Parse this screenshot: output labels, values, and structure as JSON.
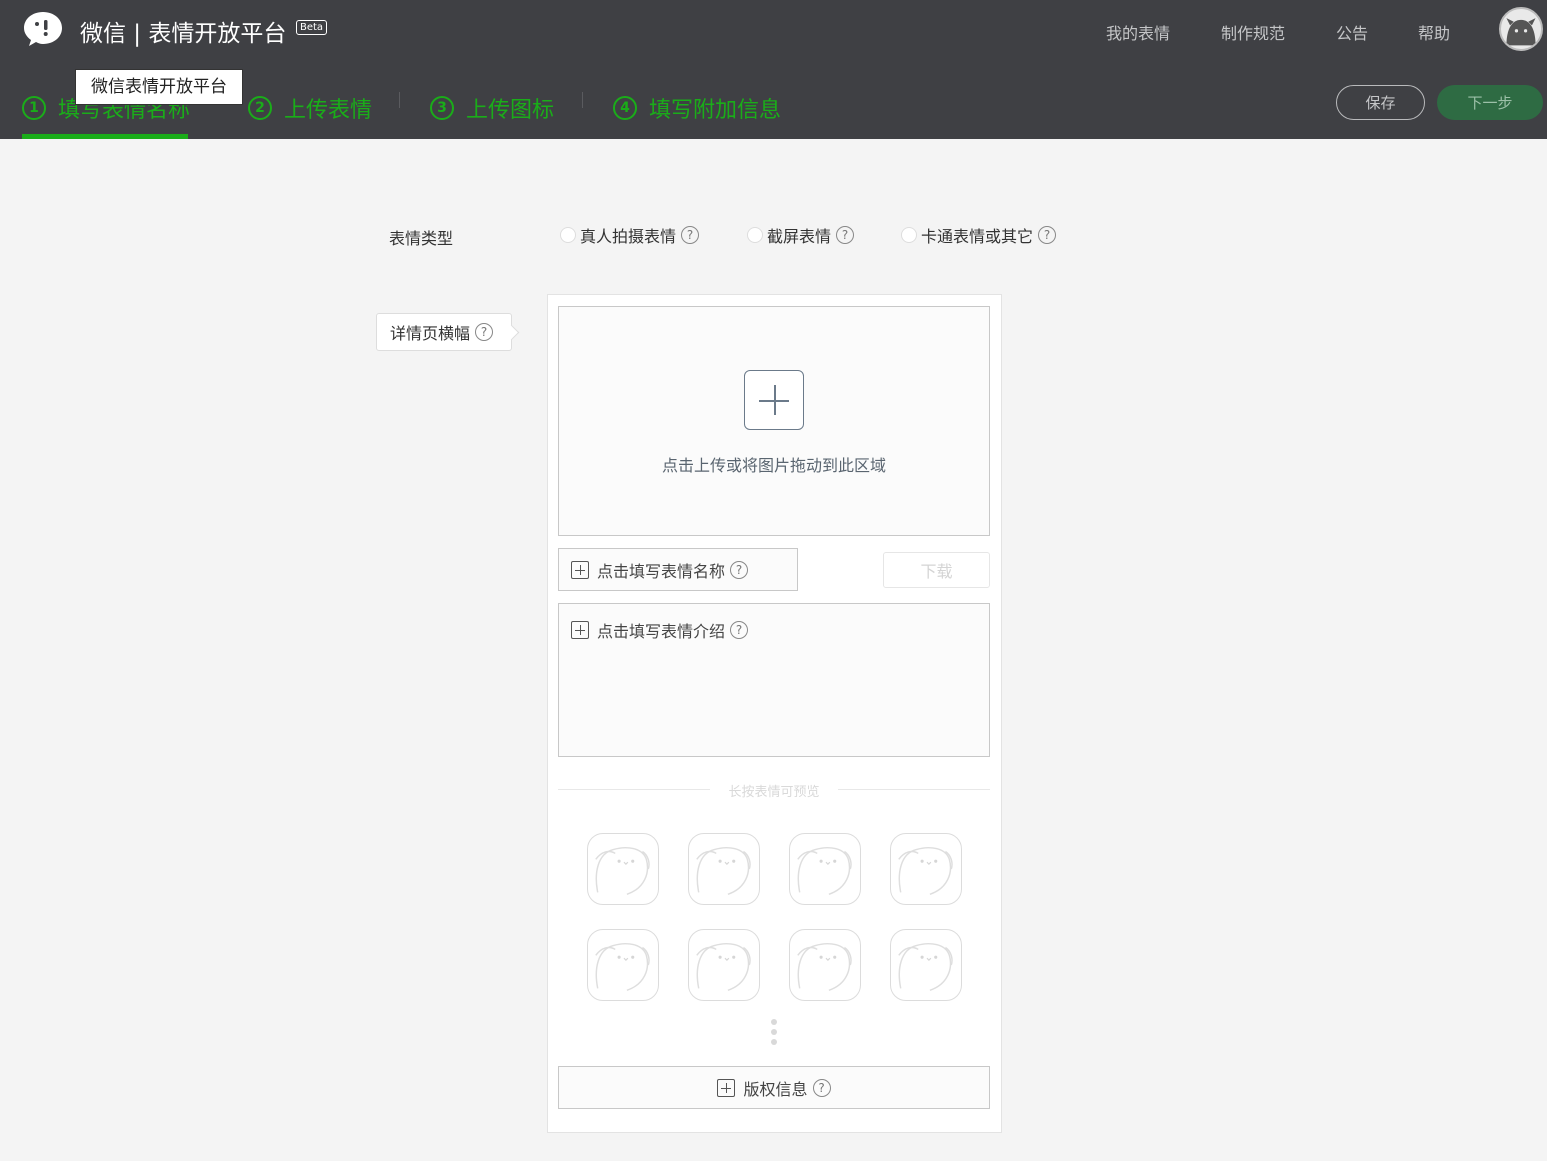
{
  "header": {
    "brand": "微信 | 表情开放平台",
    "beta": "Beta",
    "nav": [
      "我的表情",
      "制作规范",
      "公告",
      "帮助"
    ],
    "tooltip": "微信表情开放平台",
    "steps": [
      {
        "num": "1",
        "label": "填写表情名称"
      },
      {
        "num": "2",
        "label": "上传表情"
      },
      {
        "num": "3",
        "label": "上传图标"
      },
      {
        "num": "4",
        "label": "填写附加信息"
      }
    ],
    "active_step": 1,
    "save_label": "保存",
    "next_label": "下一步",
    "accent_color": "#1aad19"
  },
  "form": {
    "type_label": "表情类型",
    "type_options": [
      "真人拍摄表情",
      "截屏表情",
      "卡通表情或其它"
    ],
    "help_glyph": "?",
    "banner_label": "详情页横幅",
    "upload_hint": "点击上传或将图片拖动到此区域",
    "name_placeholder": "点击填写表情名称",
    "download_label": "下载",
    "intro_placeholder": "点击填写表情介绍",
    "preview_divider": "长按表情可预览",
    "copyright_label": "版权信息",
    "sticker_icon": "sticker-placeholder-icon"
  }
}
